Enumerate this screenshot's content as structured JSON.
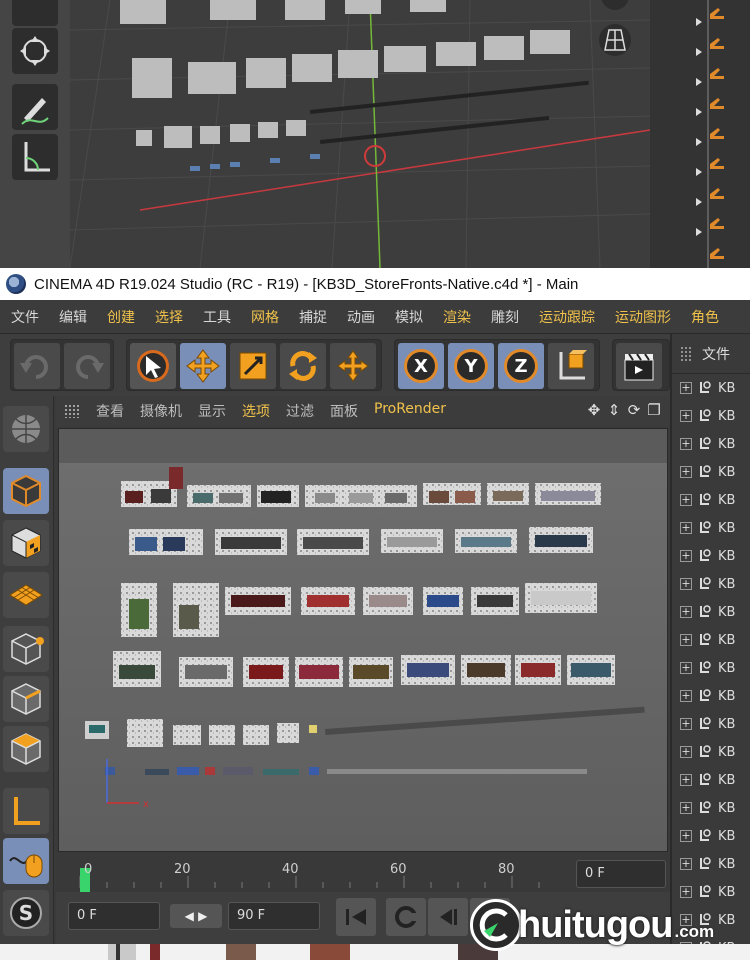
{
  "window": {
    "title": "CINEMA 4D R19.024 Studio (RC - R19) - [KB3D_StoreFronts-Native.c4d *] - Main"
  },
  "menubar": {
    "items": [
      {
        "label": "文件",
        "accent": false
      },
      {
        "label": "编辑",
        "accent": false
      },
      {
        "label": "创建",
        "accent": true
      },
      {
        "label": "选择",
        "accent": true
      },
      {
        "label": "工具",
        "accent": false
      },
      {
        "label": "网格",
        "accent": true
      },
      {
        "label": "捕捉",
        "accent": false
      },
      {
        "label": "动画",
        "accent": false
      },
      {
        "label": "模拟",
        "accent": false
      },
      {
        "label": "渲染",
        "accent": true
      },
      {
        "label": "雕刻",
        "accent": false
      },
      {
        "label": "运动跟踪",
        "accent": true
      },
      {
        "label": "运动图形",
        "accent": true
      },
      {
        "label": "角色",
        "accent": true
      }
    ]
  },
  "toolbar": {
    "axis_x": "X",
    "axis_y": "Y",
    "axis_z": "Z"
  },
  "viewport": {
    "menus": [
      {
        "label": "查看",
        "accent": false
      },
      {
        "label": "摄像机",
        "accent": false
      },
      {
        "label": "显示",
        "accent": false
      },
      {
        "label": "选项",
        "accent": true
      },
      {
        "label": "过滤",
        "accent": false
      },
      {
        "label": "面板",
        "accent": false
      },
      {
        "label": "ProRender",
        "accent": true
      }
    ]
  },
  "timeline": {
    "ticks": [
      "0",
      "20",
      "40",
      "60",
      "80"
    ],
    "end_frame": "0 F"
  },
  "playback": {
    "start_field": "0 F",
    "end_field": "90 F"
  },
  "object_manager": {
    "title": "文件",
    "rows": [
      "KB",
      "KB",
      "KB",
      "KB",
      "KB",
      "KB",
      "KB",
      "KB",
      "KB",
      "KB",
      "KB",
      "KB",
      "KB",
      "KB",
      "KB",
      "KB",
      "KB",
      "KB",
      "KB",
      "KB",
      "KB"
    ]
  },
  "watermark": {
    "text": "huitugou",
    "suffix": ".com"
  },
  "colors": {
    "accent_menu": "#f0c24b",
    "active_button": "#7a8fb8",
    "axis_ring": "#e08a2a",
    "timeline_cursor": "#3ad46c"
  }
}
